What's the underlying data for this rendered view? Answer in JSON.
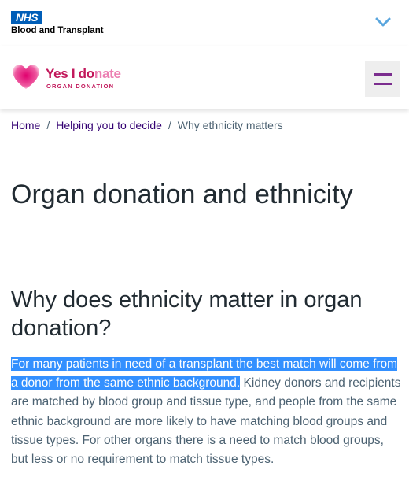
{
  "nhs": {
    "logo_text": "NHS",
    "org_name": "Blood and Transplant"
  },
  "brand": {
    "main_dark": "Yes I do",
    "main_light": "nate",
    "sub": "ORGAN DONATION"
  },
  "breadcrumb": {
    "home": "Home",
    "sep1": "/",
    "section": "Helping you to decide",
    "sep2": "/",
    "current": "Why ethnicity matters"
  },
  "page": {
    "title": "Organ donation and ethnicity",
    "subtitle": "Why does ethnicity matter in organ donation?",
    "highlighted_text": "For many patients in need of a transplant the best match will come from a donor from the same ethnic background.",
    "body_text": " Kidney donors and recipients are matched by blood group and tissue type, and people from the same ethnic background are more likely to have matching blood groups and tissue types. For other organs there is a need to match blood groups, but less or no requirement to match tissue types."
  },
  "colors": {
    "nhs_blue": "#005eb8",
    "brand_pink": "#c2185b",
    "menu_purple": "#7b2d8e",
    "selection": "#3390ff"
  },
  "icons": {
    "toggle": "chevron-down-icon",
    "menu": "hamburger-menu-icon",
    "logo": "heart-icon"
  }
}
